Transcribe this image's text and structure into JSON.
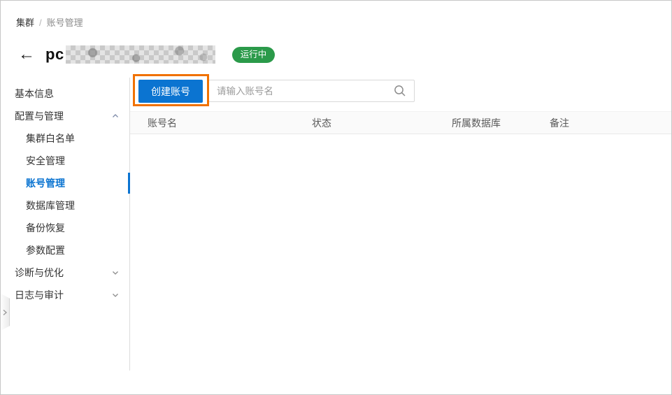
{
  "breadcrumb": {
    "items": [
      "集群",
      "账号管理"
    ],
    "separator": "/"
  },
  "header": {
    "back_icon": "←",
    "title_prefix": "pc",
    "instance_id_masked": true,
    "status": "运行中"
  },
  "sidebar": {
    "items": [
      {
        "label": "基本信息",
        "level": "top"
      },
      {
        "label": "配置与管理",
        "level": "top",
        "chevron": "up",
        "expanded": true
      },
      {
        "label": "集群白名单",
        "level": "sub"
      },
      {
        "label": "安全管理",
        "level": "sub"
      },
      {
        "label": "账号管理",
        "level": "sub",
        "active": true
      },
      {
        "label": "数据库管理",
        "level": "sub"
      },
      {
        "label": "备份恢复",
        "level": "sub"
      },
      {
        "label": "参数配置",
        "level": "sub"
      },
      {
        "label": "诊断与优化",
        "level": "top",
        "chevron": "down",
        "expanded": false
      },
      {
        "label": "日志与审计",
        "level": "top",
        "chevron": "down",
        "expanded": false
      }
    ]
  },
  "toolbar": {
    "create_button": "创建账号",
    "search_placeholder": "请输入账号名",
    "search_icon": "magnifier"
  },
  "table": {
    "headers": [
      "账号名",
      "状态",
      "所属数据库",
      "备注"
    ],
    "rows": []
  },
  "colors": {
    "primary_blue": "#0b74d1",
    "status_green": "#2b9a4a",
    "annotation_orange": "#f07100",
    "divider_gray": "#dcdcdc",
    "header_band": "#fafafa"
  }
}
